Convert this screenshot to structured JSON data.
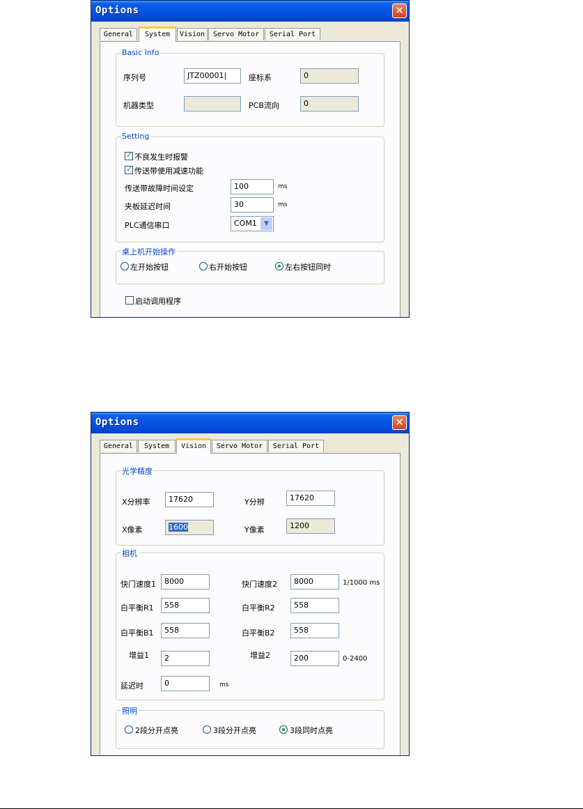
{
  "dialog1": {
    "title": "Options",
    "tabs": [
      "General",
      "System",
      "Vision",
      "Servo Motor",
      "Serial Port"
    ],
    "active_tab": "System",
    "basic_info": {
      "legend": "Basic Info",
      "serial_label": "序列号",
      "serial_value": "JTZ00001|",
      "coord_label": "座标系",
      "coord_value": "0",
      "machine_type_label": "机器类型",
      "machine_type_value": "",
      "pcb_flow_label": "PCB流向",
      "pcb_flow_value": "0"
    },
    "setting": {
      "legend": "Setting",
      "alarm_checkbox": {
        "label": "不良发生时报警",
        "checked": true
      },
      "decel_checkbox": {
        "label": "传送带使用减速功能",
        "checked": true
      },
      "fault_time_label": "传送带故障时间设定",
      "fault_time_value": "100",
      "fault_time_unit": "ms",
      "clamp_delay_label": "夹板延迟时间",
      "clamp_delay_value": "30",
      "clamp_delay_unit": "ms",
      "plc_port_label": "PLC通信串口",
      "plc_port_value": "COM1"
    },
    "desktop_start": {
      "legend": "桌上机开始操作",
      "options": [
        "左开始按钮",
        "右开始按钮",
        "左右按钮同时"
      ],
      "selected_index": 2
    },
    "debug_checkbox": {
      "label": "启动调用程序",
      "checked": false
    }
  },
  "dialog2": {
    "title": "Options",
    "tabs": [
      "General",
      "System",
      "Vision",
      "Servo Motor",
      "Serial Port"
    ],
    "active_tab": "Vision",
    "optics": {
      "legend": "光学精度",
      "x_res_label": "X分辨率",
      "x_res_value": "17620",
      "y_res_label": "Y分辨",
      "y_res_value": "17620",
      "x_pixel_label": "X像素",
      "x_pixel_value": "1600",
      "y_pixel_label": "Y像素",
      "y_pixel_value": "1200"
    },
    "camera": {
      "legend": "相机",
      "shutter1_label": "快门速度1",
      "shutter1_value": "8000",
      "shutter2_label": "快门速度2",
      "shutter2_value": "8000",
      "shutter_unit": "1/1000 ms",
      "wb_r1_label": "白平衡R1",
      "wb_r1_value": "558",
      "wb_r2_label": "白平衡R2",
      "wb_r2_value": "558",
      "wb_b1_label": "白平衡B1",
      "wb_b1_value": "558",
      "wb_b2_label": "白平衡B2",
      "wb_b2_value": "558",
      "gain1_label": "增益1",
      "gain1_value": "2",
      "gain2_label": "增益2",
      "gain2_value": "200",
      "gain_range": "0-2400",
      "delay_label": "延迟时",
      "delay_value": "0",
      "delay_unit": "ms"
    },
    "lighting": {
      "legend": "照明",
      "options": [
        "2段分开点亮",
        "3段分开点亮",
        "3段同时点亮"
      ],
      "selected_index": 2
    }
  },
  "colors": {
    "titlebar": "#0554e3",
    "dialog_bg": "#ece9d8",
    "panel_bg": "#fcfcfe",
    "group_legend": "#0046d5",
    "check_mark": "#21a121",
    "close_button": "#d9532c",
    "active_tab_accent": "#ffc83c",
    "selection": "#316ac5"
  }
}
